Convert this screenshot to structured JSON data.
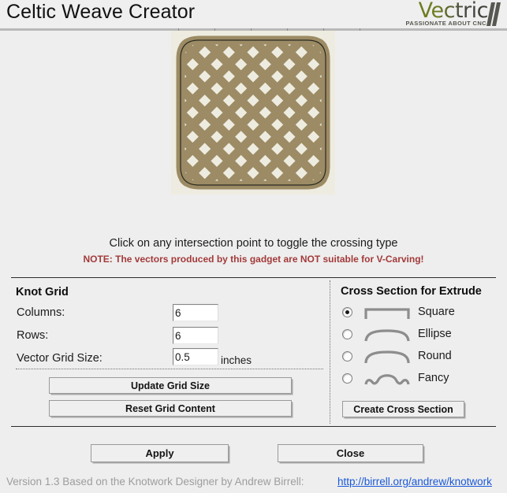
{
  "header": {
    "title": "Celtic Weave Creator",
    "logo_word": "Vectric",
    "logo_tagline": "PASSIONATE ABOUT CNC"
  },
  "preview": {
    "icon": "celtic-knot-preview",
    "knot_color": "#9c8b64",
    "outline_color": "#2a2a20",
    "background_color": "#eeece0",
    "columns": 6,
    "rows": 6
  },
  "instructions": {
    "primary": "Click on any intersection point to toggle the crossing type",
    "note": "NOTE: The vectors produced by this gadget are NOT suitable for V-Carving!",
    "note_color": "#a33a3a"
  },
  "knot_grid": {
    "title": "Knot Grid",
    "fields": [
      {
        "label": "Columns:",
        "value": "6",
        "suffix": ""
      },
      {
        "label": "Rows:",
        "value": "6",
        "suffix": ""
      },
      {
        "label": "Vector Grid Size:",
        "value": "0.5",
        "suffix": "inches"
      }
    ],
    "update_button": "Update Grid Size",
    "reset_button": "Reset Grid Content"
  },
  "cross_section": {
    "title": "Cross Section for Extrude",
    "options": [
      {
        "label": "Square",
        "icon": "profile-square-icon",
        "selected": true
      },
      {
        "label": "Ellipse",
        "icon": "profile-ellipse-icon",
        "selected": false
      },
      {
        "label": "Round",
        "icon": "profile-round-icon",
        "selected": false
      },
      {
        "label": "Fancy",
        "icon": "profile-fancy-icon",
        "selected": false
      }
    ],
    "create_button": "Create Cross Section"
  },
  "dialog_buttons": {
    "apply": "Apply",
    "close": "Close"
  },
  "footer": {
    "text": "Version 1.3 Based on the Knotwork Designer by Andrew Birrell:",
    "link": "http://birrell.org/andrew/knotwork",
    "link_color": "#1a59d8"
  }
}
